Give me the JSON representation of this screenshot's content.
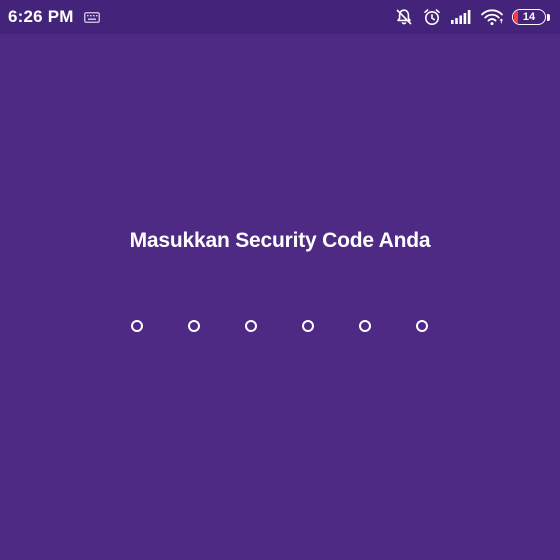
{
  "status_bar": {
    "time": "6:26 PM",
    "battery_level": "14",
    "icons": [
      "keyboard-icon",
      "notifications-off-icon",
      "alarm-icon",
      "signal-icon",
      "wifi-icon",
      "battery-icon"
    ]
  },
  "security": {
    "title": "Masukkan Security Code Anda",
    "pin_length": 6,
    "entered_digits": 0
  },
  "colors": {
    "background": "#4e2a84",
    "status_bar": "#44237a",
    "text": "#ffffff",
    "battery_low": "#ff3b3b"
  }
}
